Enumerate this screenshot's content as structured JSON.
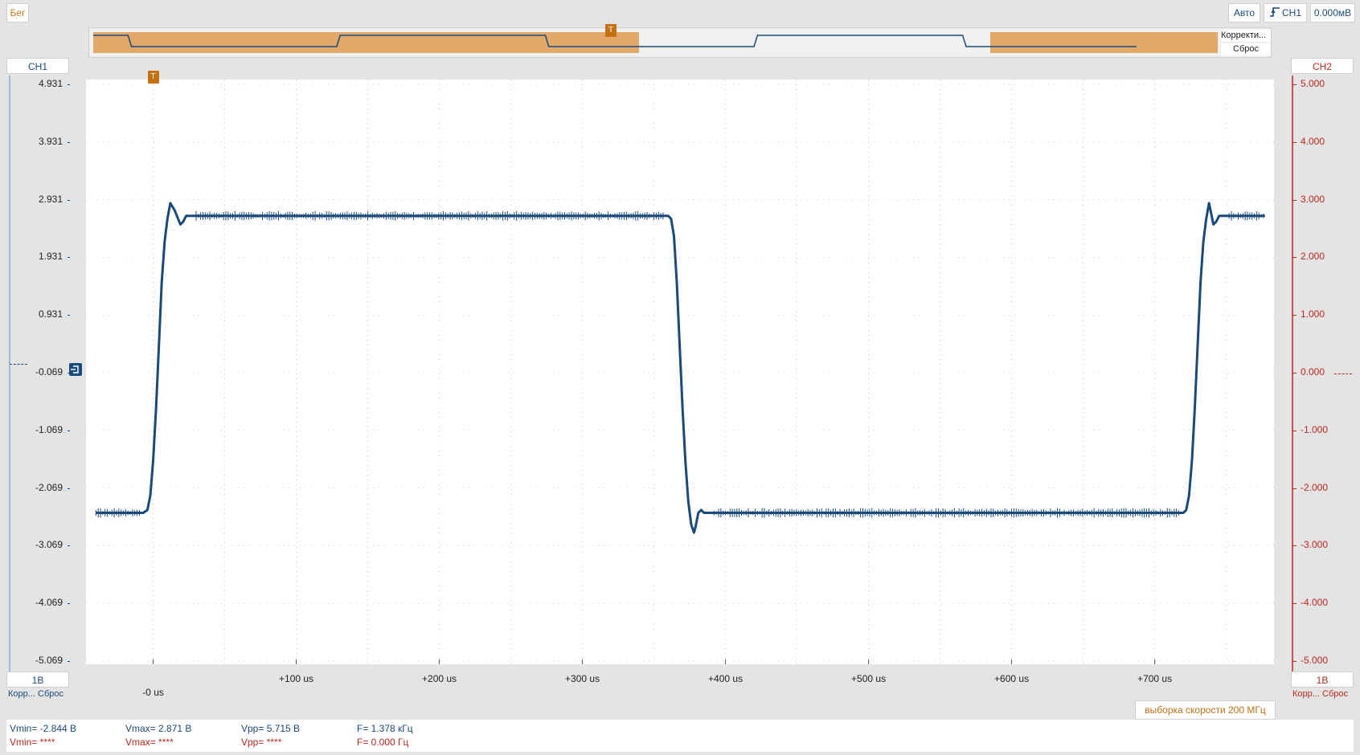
{
  "toolbar": {
    "status": "Бег",
    "mode": "Авто",
    "trigger_source": "CH1",
    "trigger_level": "0.000мВ"
  },
  "overview": {
    "menu_item_1": "Корректи...",
    "menu_item_2": "Сброс",
    "trigger_marker": "T"
  },
  "ch1": {
    "name": "CH1",
    "scale": "1В",
    "corr": "Корр...",
    "reset": "Сброс",
    "color": "#1a4a7a",
    "ticks": [
      "4.931",
      "3.931",
      "2.931",
      "1.931",
      "0.931",
      "-0.069",
      "-1.069",
      "-2.069",
      "-3.069",
      "-4.069",
      "-5.069"
    ]
  },
  "ch2": {
    "name": "CH2",
    "scale": "1В",
    "corr": "Корр...",
    "reset": "Сброс",
    "color": "#c0281e",
    "ticks": [
      "5.000",
      "4.000",
      "3.000",
      "2.000",
      "1.000",
      "0.000",
      "-1.000",
      "-2.000",
      "-3.000",
      "-4.000",
      "-5.000"
    ]
  },
  "plot": {
    "trigger_marker": "T",
    "time_labels": [
      "-0 us",
      "+100 us",
      "+200 us",
      "+300 us",
      "+400 us",
      "+500 us",
      "+600 us",
      "+700 us"
    ]
  },
  "sample_rate": "выборка скорости 200 МГц",
  "measurements": {
    "ch1": {
      "vmin": "Vmin= -2.844 В",
      "vmax": "Vmax= 2.871 В",
      "vpp": "Vpp= 5.715 В",
      "freq": "F= 1.378 кГц"
    },
    "ch2": {
      "vmin": "Vmin= ****",
      "vmax": "Vmax= ****",
      "vpp": "Vpp= ****",
      "freq": "F= 0.000 Гц"
    }
  },
  "chart_data": {
    "type": "line",
    "xlabel": "",
    "ylabel": "",
    "xlim": [
      -43,
      780
    ],
    "ylim": [
      -5.069,
      4.931
    ],
    "grid": true,
    "series": [
      {
        "name": "CH1",
        "color": "#1a4a7a",
        "x": [
          -40,
          -7,
          -4,
          -2,
          0,
          2,
          4,
          6,
          8,
          10,
          12,
          15,
          19,
          21,
          23,
          27,
          30,
          360,
          362,
          364,
          366,
          368,
          370,
          372,
          374,
          376,
          378,
          379,
          381,
          383,
          385,
          390,
          395,
          720,
          722,
          724,
          726,
          728,
          730,
          732,
          734,
          736,
          738,
          739,
          741,
          743,
          745,
          750,
          755,
          777
        ],
        "values": [
          -2.5,
          -2.5,
          -2.45,
          -2.2,
          -1.6,
          -0.7,
          0.4,
          1.5,
          2.2,
          2.6,
          2.871,
          2.75,
          2.5,
          2.55,
          2.65,
          2.65,
          2.65,
          2.65,
          2.6,
          2.3,
          1.5,
          0.4,
          -0.7,
          -1.6,
          -2.3,
          -2.7,
          -2.844,
          -2.75,
          -2.5,
          -2.45,
          -2.5,
          -2.5,
          -2.5,
          -2.5,
          -2.45,
          -2.2,
          -1.6,
          -0.7,
          0.4,
          1.5,
          2.2,
          2.6,
          2.871,
          2.75,
          2.5,
          2.55,
          2.65,
          2.65,
          2.65,
          2.65
        ]
      }
    ]
  }
}
